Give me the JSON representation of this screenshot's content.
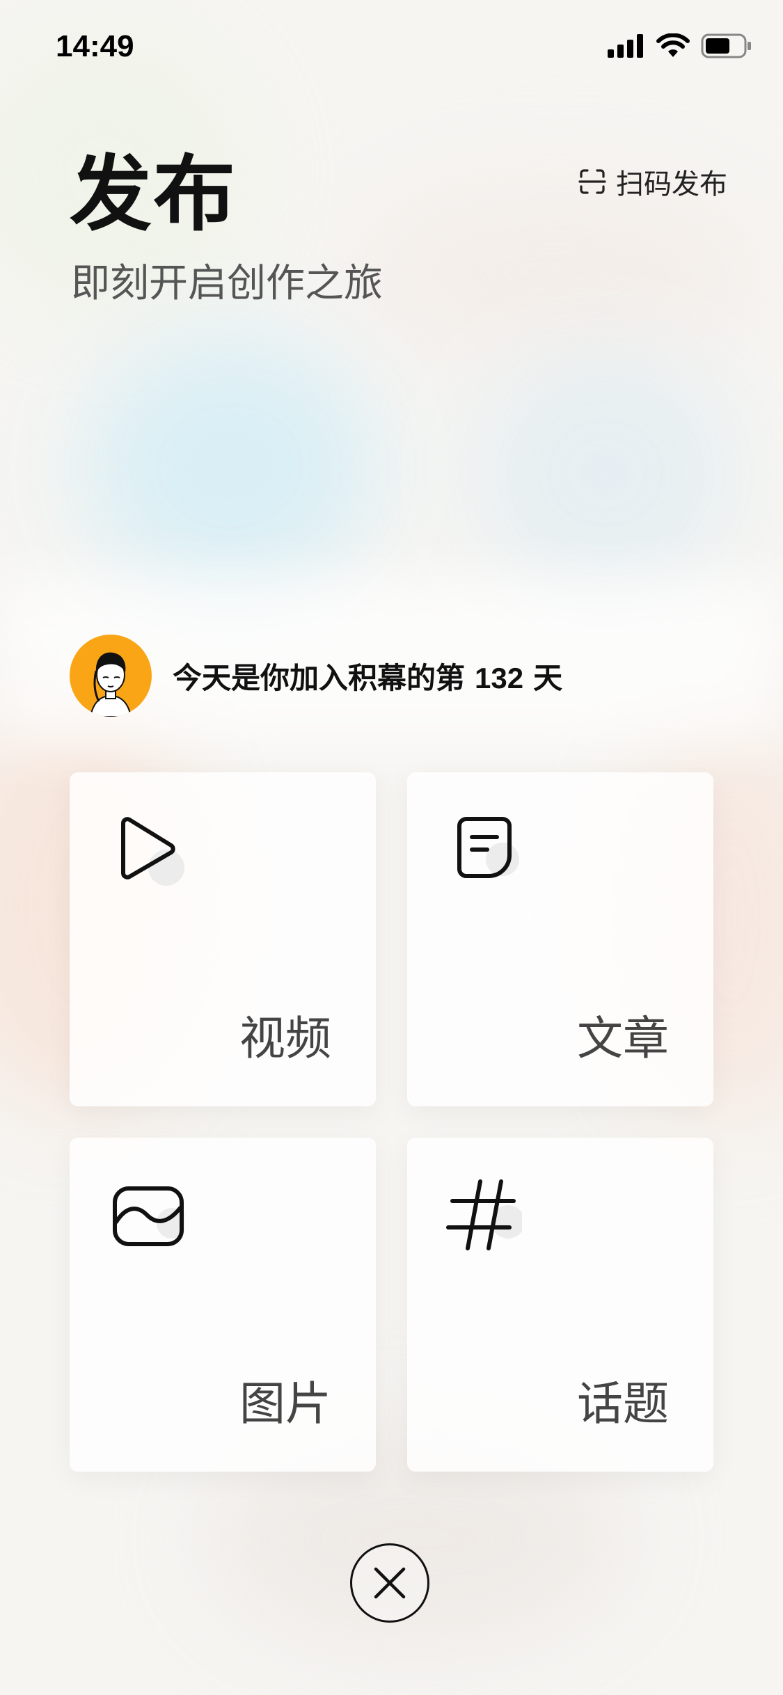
{
  "status_bar": {
    "time": "14:49",
    "icons": [
      "cellular-signal-icon",
      "wifi-icon",
      "battery-icon"
    ]
  },
  "header": {
    "title": "发布",
    "subtitle": "即刻开启创作之旅",
    "scan_publish_label": "扫码发布",
    "scan_icon": "scan-icon"
  },
  "welcome": {
    "prefix": "今天是你加入积幕的第",
    "days": "132",
    "suffix": "天"
  },
  "options": [
    {
      "label": "视频",
      "icon": "play-icon"
    },
    {
      "label": "文章",
      "icon": "article-icon"
    },
    {
      "label": "图片",
      "icon": "image-icon"
    },
    {
      "label": "话题",
      "icon": "hashtag-icon"
    }
  ],
  "close": {
    "icon": "close-icon"
  },
  "colors": {
    "avatar_bg": "#f9a515",
    "text_primary": "#111111",
    "text_secondary": "#555555"
  }
}
